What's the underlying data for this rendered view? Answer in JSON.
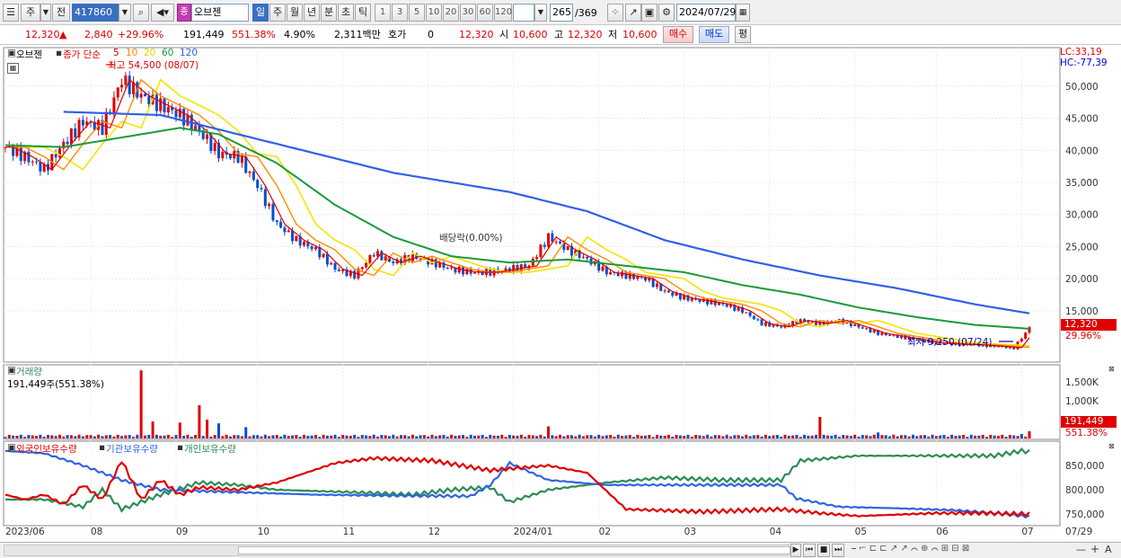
{
  "toolbar": {
    "type_label": "주",
    "prev_label": "전",
    "code": "417860",
    "name": "오브젠",
    "name_badge": "종",
    "periods": [
      "일",
      "주",
      "월",
      "년",
      "분",
      "초",
      "틱"
    ],
    "intervals": [
      "1",
      "3",
      "5",
      "10",
      "20",
      "30",
      "60",
      "120"
    ],
    "count": "265",
    "total": "/369",
    "date": "2024/07/29"
  },
  "info": {
    "price": "12,320",
    "change": "2,840",
    "change_pct": "+29.96%",
    "volume": "191,449",
    "volume_pct": "551.38%",
    "turnover": "4.90%",
    "value": "2,311백만",
    "bid_label": "호가",
    "bid": "0",
    "bid_price": "12,320",
    "open_label": "시",
    "open": "10,600",
    "high_label": "고",
    "high": "12,320",
    "low_label": "저",
    "low": "10,600",
    "buy": "매수",
    "sell": "매도",
    "avg": "평"
  },
  "price_panel": {
    "name": "오브젠",
    "indicator_label": "종가 단순",
    "ma_periods": [
      "5",
      "10",
      "20",
      "60",
      "120"
    ],
    "lc": "LC:33,19",
    "hc": "HC:-77,39",
    "high_label": "최고 54,500 (08/07)",
    "low_label": "최저 9,250 (07/24)",
    "dividend_label": "배당락(0.00%)",
    "current_tag": "12,320",
    "current_pct": "29.96%"
  },
  "volume_panel": {
    "name": "거래량",
    "value_label": "191,449주(551.38%)",
    "tag": "191,449",
    "pct": "551.38%"
  },
  "holding_panel": {
    "foreign": "외국인보유수량",
    "inst": "기관보유수량",
    "indiv": "개인보유수량"
  },
  "colors": {
    "up": "#e00000",
    "down": "#0050d0",
    "ma5": "#e00000",
    "ma10": "#ff8a00",
    "ma20": "#f5e400",
    "ma60": "#1a9a3a",
    "ma120": "#3060e8",
    "foreign": "#e00000",
    "inst": "#2f66e0",
    "indiv": "#2e8b57"
  },
  "chart_data": {
    "type": "candlestick",
    "x_ticks": [
      "2023/06",
      "08",
      "09",
      "10",
      "11",
      "12",
      "2024/01",
      "02",
      "03",
      "04",
      "05",
      "06",
      "07",
      "07/29"
    ],
    "price_ylim": [
      7000,
      56000
    ],
    "price_ticks": [
      "50,000",
      "45,000",
      "40,000",
      "35,000",
      "30,000",
      "25,000",
      "20,000",
      "15,000"
    ],
    "price_points": [
      [
        0,
        40500
      ],
      [
        5,
        39000
      ],
      [
        10,
        37000
      ],
      [
        15,
        41000
      ],
      [
        20,
        44500
      ],
      [
        25,
        43500
      ],
      [
        30,
        51000
      ],
      [
        35,
        48500
      ],
      [
        40,
        47000
      ],
      [
        45,
        45500
      ],
      [
        50,
        43000
      ],
      [
        55,
        39500
      ],
      [
        60,
        39000
      ],
      [
        65,
        34500
      ],
      [
        70,
        28500
      ],
      [
        75,
        26000
      ],
      [
        80,
        24500
      ],
      [
        85,
        21500
      ],
      [
        90,
        20500
      ],
      [
        95,
        24000
      ],
      [
        100,
        22500
      ],
      [
        105,
        23500
      ],
      [
        110,
        22500
      ],
      [
        115,
        21500
      ],
      [
        120,
        21000
      ],
      [
        125,
        21000
      ],
      [
        130,
        21500
      ],
      [
        135,
        22000
      ],
      [
        140,
        26500
      ],
      [
        145,
        24500
      ],
      [
        150,
        23000
      ],
      [
        155,
        21000
      ],
      [
        160,
        20500
      ],
      [
        165,
        20000
      ],
      [
        170,
        18000
      ],
      [
        175,
        17000
      ],
      [
        180,
        16500
      ],
      [
        185,
        16000
      ],
      [
        190,
        15000
      ],
      [
        195,
        13000
      ],
      [
        200,
        12500
      ],
      [
        205,
        13500
      ],
      [
        210,
        13000
      ],
      [
        215,
        13500
      ],
      [
        220,
        12500
      ],
      [
        225,
        11500
      ],
      [
        230,
        11000
      ],
      [
        235,
        10500
      ],
      [
        240,
        10000
      ],
      [
        245,
        9800
      ],
      [
        250,
        9700
      ],
      [
        255,
        9500
      ],
      [
        260,
        9250
      ],
      [
        264,
        12320
      ]
    ],
    "ma120_points": [
      [
        15,
        46000
      ],
      [
        40,
        45500
      ],
      [
        60,
        42500
      ],
      [
        80,
        39500
      ],
      [
        100,
        36500
      ],
      [
        130,
        33500
      ],
      [
        150,
        30500
      ],
      [
        170,
        26000
      ],
      [
        190,
        23000
      ],
      [
        210,
        20500
      ],
      [
        230,
        18500
      ],
      [
        250,
        16000
      ],
      [
        264,
        14600
      ]
    ],
    "ma60_points": [
      [
        0,
        40800
      ],
      [
        15,
        40500
      ],
      [
        30,
        42000
      ],
      [
        45,
        43500
      ],
      [
        55,
        42500
      ],
      [
        70,
        38000
      ],
      [
        85,
        31500
      ],
      [
        100,
        26500
      ],
      [
        115,
        23500
      ],
      [
        130,
        22500
      ],
      [
        145,
        23000
      ],
      [
        160,
        22000
      ],
      [
        175,
        21000
      ],
      [
        190,
        19000
      ],
      [
        205,
        17500
      ],
      [
        220,
        15500
      ],
      [
        235,
        14000
      ],
      [
        250,
        12800
      ],
      [
        264,
        12200
      ]
    ],
    "volume_ylim": [
      0,
      1900000
    ],
    "volume_ticks": [
      "1,500K",
      "1,000K",
      "500,000"
    ],
    "volume_latest": 191449,
    "volume_spikes": [
      [
        35,
        1800000
      ],
      [
        38,
        450000
      ],
      [
        45,
        420000
      ],
      [
        50,
        880000
      ],
      [
        52,
        500000
      ],
      [
        55,
        400000
      ],
      [
        62,
        300000
      ],
      [
        140,
        320000
      ],
      [
        210,
        570000
      ],
      [
        225,
        160000
      ],
      [
        262,
        120000
      ],
      [
        264,
        191449
      ]
    ],
    "holding_ylim": [
      730000,
      900000
    ],
    "holding_ticks": [
      "850,000",
      "800,000",
      "750,000"
    ],
    "foreign_points": [
      [
        0,
        790000
      ],
      [
        5,
        780000
      ],
      [
        10,
        790000
      ],
      [
        15,
        770000
      ],
      [
        20,
        810000
      ],
      [
        25,
        780000
      ],
      [
        30,
        860000
      ],
      [
        35,
        780000
      ],
      [
        40,
        820000
      ],
      [
        45,
        790000
      ],
      [
        50,
        805000
      ],
      [
        60,
        800000
      ],
      [
        70,
        815000
      ],
      [
        85,
        855000
      ],
      [
        95,
        865000
      ],
      [
        110,
        860000
      ],
      [
        125,
        840000
      ],
      [
        140,
        850000
      ],
      [
        150,
        835000
      ],
      [
        160,
        760000
      ],
      [
        180,
        755000
      ],
      [
        200,
        760000
      ],
      [
        210,
        752000
      ],
      [
        220,
        746000
      ],
      [
        240,
        752000
      ],
      [
        252,
        752000
      ],
      [
        264,
        750000
      ]
    ],
    "inst_points": [
      [
        0,
        880000
      ],
      [
        10,
        875000
      ],
      [
        20,
        850000
      ],
      [
        25,
        835000
      ],
      [
        30,
        820000
      ],
      [
        40,
        800000
      ],
      [
        60,
        795000
      ],
      [
        80,
        790000
      ],
      [
        100,
        788000
      ],
      [
        120,
        787000
      ],
      [
        125,
        810000
      ],
      [
        130,
        855000
      ],
      [
        140,
        820000
      ],
      [
        155,
        810000
      ],
      [
        170,
        810000
      ],
      [
        185,
        810000
      ],
      [
        200,
        810000
      ],
      [
        204,
        782000
      ],
      [
        215,
        765000
      ],
      [
        230,
        762000
      ],
      [
        245,
        758000
      ],
      [
        255,
        752000
      ],
      [
        264,
        745000
      ]
    ],
    "indiv_points": [
      [
        0,
        780000
      ],
      [
        10,
        780000
      ],
      [
        20,
        765000
      ],
      [
        25,
        800000
      ],
      [
        30,
        760000
      ],
      [
        40,
        790000
      ],
      [
        50,
        815000
      ],
      [
        60,
        810000
      ],
      [
        70,
        800000
      ],
      [
        90,
        795000
      ],
      [
        105,
        790000
      ],
      [
        115,
        800000
      ],
      [
        125,
        805000
      ],
      [
        130,
        775000
      ],
      [
        140,
        800000
      ],
      [
        155,
        815000
      ],
      [
        170,
        825000
      ],
      [
        185,
        820000
      ],
      [
        200,
        820000
      ],
      [
        205,
        860000
      ],
      [
        220,
        870000
      ],
      [
        240,
        870000
      ],
      [
        255,
        870000
      ],
      [
        262,
        880000
      ],
      [
        264,
        878000
      ]
    ]
  }
}
